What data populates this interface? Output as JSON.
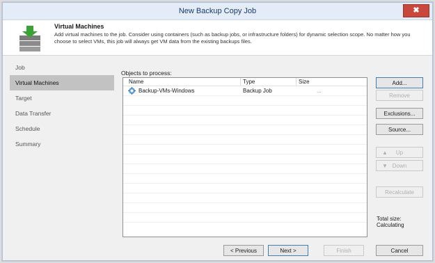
{
  "window": {
    "title": "New Backup Copy Job",
    "close_label": "✖"
  },
  "header": {
    "heading": "Virtual Machines",
    "description": "Add virtual machines to the job. Consider using containers (such as backup jobs, or infrastructure folders) for dynamic selection scope. No matter how you choose to select VMs, this job will always get VM data from the existing backups files."
  },
  "nav": {
    "items": [
      "Job",
      "Virtual Machines",
      "Target",
      "Data Transfer",
      "Schedule",
      "Summary"
    ],
    "active_index": 1
  },
  "objects": {
    "label": "Objects to process:",
    "columns": [
      "Name",
      "Type",
      "Size"
    ],
    "rows": [
      {
        "name": "Backup-VMs-Windows",
        "type": "Backup Job",
        "size": "..."
      }
    ]
  },
  "side_buttons": {
    "add": "Add...",
    "remove": "Remove",
    "exclusions": "Exclusions...",
    "source": "Source...",
    "up": "Up",
    "down": "Down",
    "recalculate": "Recalculate"
  },
  "total": {
    "label": "Total size:",
    "value": "Calculating"
  },
  "footer": {
    "previous": "< Previous",
    "next": "Next >",
    "finish": "Finish",
    "cancel": "Cancel"
  },
  "colors": {
    "accent": "#1f6fb0",
    "title_text": "#1a3a6a",
    "close_red": "#c9483c"
  }
}
